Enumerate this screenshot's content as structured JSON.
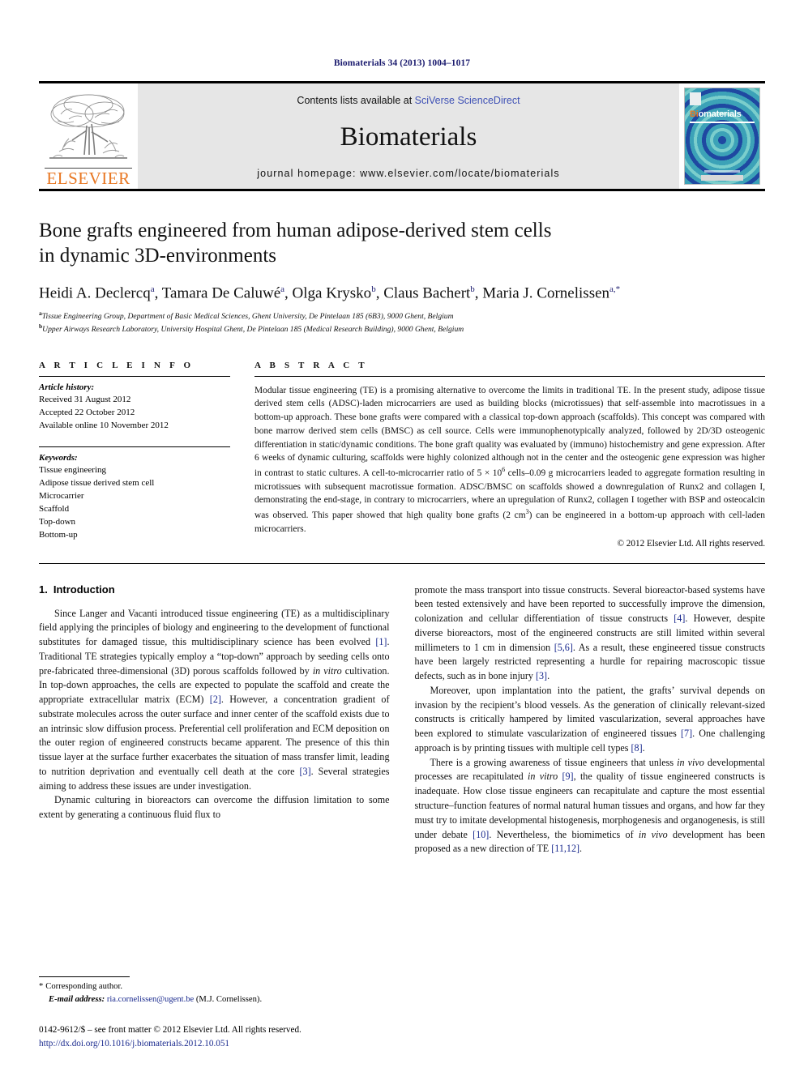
{
  "running_head": "Biomaterials 34 (2013) 1004–1017",
  "masthead": {
    "contents_prefix": "Contents lists available at ",
    "contents_link": "SciVerse ScienceDirect",
    "journal_name": "Biomaterials",
    "homepage": "journal homepage: www.elsevier.com/locate/biomaterials",
    "publisher": "ELSEVIER",
    "cover_title_first": "Bi",
    "cover_title_rest": "omaterials",
    "publisher_icon": "elsevier-tree-icon",
    "cover_icon": "journal-cover-thumbnail"
  },
  "article": {
    "title_line1": "Bone grafts engineered from human adipose-derived stem cells",
    "title_line2": "in dynamic 3D-environments",
    "authors": [
      {
        "name": "Heidi A. Declercq",
        "sup": "a",
        "sep": ", "
      },
      {
        "name": "Tamara De Caluwé",
        "sup": "a",
        "sep": ", "
      },
      {
        "name": "Olga Krysko",
        "sup": "b",
        "sep": ", "
      },
      {
        "name": "Claus Bachert",
        "sup": "b",
        "sep": ", "
      },
      {
        "name": "Maria J. Cornelissen",
        "sup": "a,*",
        "sep": ""
      }
    ],
    "affiliations": [
      {
        "marker": "a",
        "text": "Tissue Engineering Group, Department of Basic Medical Sciences, Ghent University, De Pintelaan 185 (6B3), 9000 Ghent, Belgium"
      },
      {
        "marker": "b",
        "text": "Upper Airways Research Laboratory, University Hospital Ghent, De Pintelaan 185 (Medical Research Building), 9000 Ghent, Belgium"
      }
    ]
  },
  "article_info": {
    "heading": "A R T I C L E  I N F O",
    "history_label": "Article history:",
    "history": [
      "Received 31 August 2012",
      "Accepted 22 October 2012",
      "Available online 10 November 2012"
    ],
    "keywords_label": "Keywords:",
    "keywords": [
      "Tissue engineering",
      "Adipose tissue derived stem cell",
      "Microcarrier",
      "Scaffold",
      "Top-down",
      "Bottom-up"
    ]
  },
  "abstract": {
    "heading": "A B S T R A C T",
    "text_part1": "Modular tissue engineering (TE) is a promising alternative to overcome the limits in traditional TE. In the present study, adipose tissue derived stem cells (ADSC)-laden microcarriers are used as building blocks (microtissues) that self-assemble into macrotissues in a bottom-up approach. These bone grafts were compared with a classical top-down approach (scaffolds). This concept was compared with bone marrow derived stem cells (BMSC) as cell source. Cells were immunophenotypically analyzed, followed by 2D/3D osteogenic differentiation in static/dynamic conditions. The bone graft quality was evaluated by (immuno) histochemistry and gene expression. After 6 weeks of dynamic culturing, scaffolds were highly colonized although not in the center and the osteogenic gene expression was higher in contrast to static cultures. A cell-to-microcarrier ratio of 5 × 10",
    "sup1": "6",
    "text_part2": " cells–0.09 g microcarriers leaded to aggregate formation resulting in microtissues with subsequent macrotissue formation. ADSC/BMSC on scaffolds showed a downregulation of Runx2 and collagen I, demonstrating the end-stage, in contrary to microcarriers, where an upregulation of Runx2, collagen I together with BSP and osteocalcin was observed. This paper showed that high quality bone grafts (2 cm",
    "sup2": "3",
    "text_part3": ") can be engineered in a bottom-up approach with cell-laden microcarriers.",
    "copyright": "© 2012 Elsevier Ltd. All rights reserved."
  },
  "body": {
    "section_number": "1.",
    "section_title": "Introduction",
    "left_paragraphs": [
      {
        "segments": [
          {
            "t": "Since Langer and Vacanti introduced tissue engineering (TE) as a multidisciplinary field applying the principles of biology and engineering to the development of functional substitutes for damaged tissue, this multidisciplinary science has been evolved "
          },
          {
            "t": "[1]",
            "ref": true
          },
          {
            "t": ". Traditional TE strategies typically employ a “top-down” approach by seeding cells onto pre-fabricated three-dimensional (3D) porous scaffolds followed by "
          },
          {
            "t": "in vitro",
            "ital": true
          },
          {
            "t": " cultivation. In top-down approaches, the cells are expected to populate the scaffold and create the appropriate extracellular matrix (ECM) "
          },
          {
            "t": "[2]",
            "ref": true
          },
          {
            "t": ". However, a concentration gradient of substrate molecules across the outer surface and inner center of the scaffold exists due to an intrinsic slow diffusion process. Preferential cell proliferation and ECM deposition on the outer region of engineered constructs became apparent. The presence of this thin tissue layer at the surface further exacerbates the situation of mass transfer limit, leading to nutrition deprivation and eventually cell death at the core "
          },
          {
            "t": "[3]",
            "ref": true
          },
          {
            "t": ". Several strategies aiming to address these issues are under investigation."
          }
        ]
      },
      {
        "segments": [
          {
            "t": "Dynamic culturing in bioreactors can overcome the diffusion limitation to some extent by generating a continuous fluid flux to"
          }
        ]
      }
    ],
    "right_paragraphs": [
      {
        "first": true,
        "segments": [
          {
            "t": "promote the mass transport into tissue constructs. Several bioreactor-based systems have been tested extensively and have been reported to successfully improve the dimension, colonization and cellular differentiation of tissue constructs "
          },
          {
            "t": "[4]",
            "ref": true
          },
          {
            "t": ". However, despite diverse bioreactors, most of the engineered constructs are still limited within several millimeters to 1 cm in dimension "
          },
          {
            "t": "[5,6]",
            "ref": true
          },
          {
            "t": ". As a result, these engineered tissue constructs have been largely restricted representing a hurdle for repairing macroscopic tissue defects, such as in bone injury "
          },
          {
            "t": "[3]",
            "ref": true
          },
          {
            "t": "."
          }
        ]
      },
      {
        "segments": [
          {
            "t": "Moreover, upon implantation into the patient, the grafts’ survival depends on invasion by the recipient’s blood vessels. As the generation of clinically relevant-sized constructs is critically hampered by limited vascularization, several approaches have been explored to stimulate vascularization of engineered tissues "
          },
          {
            "t": "[7]",
            "ref": true
          },
          {
            "t": ". One challenging approach is by printing tissues with multiple cell types "
          },
          {
            "t": "[8]",
            "ref": true
          },
          {
            "t": "."
          }
        ]
      },
      {
        "segments": [
          {
            "t": "There is a growing awareness of tissue engineers that unless "
          },
          {
            "t": "in vivo",
            "ital": true
          },
          {
            "t": " developmental processes are recapitulated "
          },
          {
            "t": "in vitro",
            "ital": true
          },
          {
            "t": " "
          },
          {
            "t": "[9]",
            "ref": true
          },
          {
            "t": ", the quality of tissue engineered constructs is inadequate. How close tissue engineers can recapitulate and capture the most essential structure–function features of normal natural human tissues and organs, and how far they must try to imitate developmental histogenesis, morphogenesis and organogenesis, is still under debate "
          },
          {
            "t": "[10]",
            "ref": true
          },
          {
            "t": ". Nevertheless, the biomimetics of "
          },
          {
            "t": "in vivo",
            "ital": true
          },
          {
            "t": " development has been proposed as a new direction of TE "
          },
          {
            "t": "[11,12]",
            "ref": true
          },
          {
            "t": "."
          }
        ]
      }
    ]
  },
  "footer": {
    "corresponding_marker": "*",
    "corresponding_label": "Corresponding author.",
    "email_label": "E-mail address:",
    "email": "ria.cornelissen@ugent.be",
    "email_owner": "(M.J. Cornelissen).",
    "issn_line": "0142-9612/$ – see front matter © 2012 Elsevier Ltd. All rights reserved.",
    "doi": "http://dx.doi.org/10.1016/j.biomaterials.2012.10.051"
  },
  "colors": {
    "link": "#1a2a8e",
    "sciencedirect": "#3f51b5",
    "elsevier_orange": "#E87722",
    "running_head": "#1a1a6e"
  }
}
